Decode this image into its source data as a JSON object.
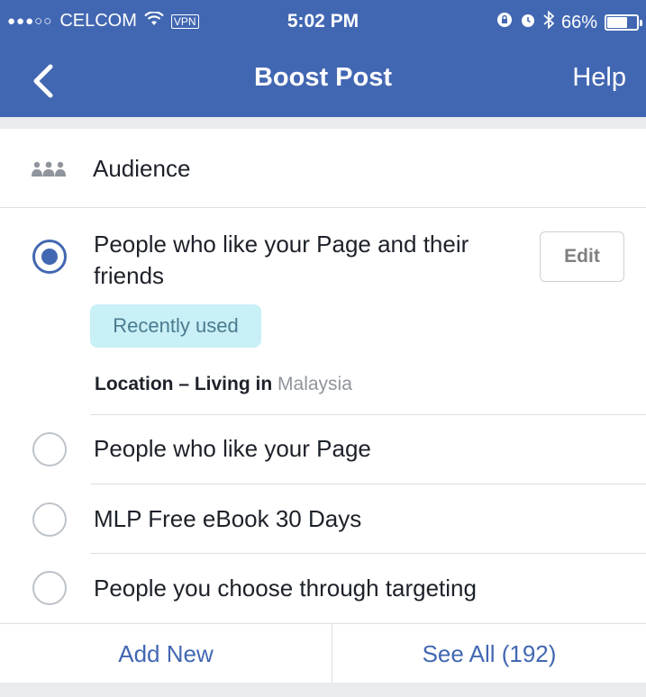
{
  "status_bar": {
    "carrier": "CELCOM",
    "vpn": "VPN",
    "time": "5:02 PM",
    "battery_text": "66%",
    "battery_level": 0.66
  },
  "nav": {
    "title": "Boost Post",
    "help_label": "Help",
    "back_icon": "chevron-left-icon"
  },
  "audience": {
    "header": "Audience",
    "header_icon": "people-icon",
    "options": [
      {
        "label": "People who like your Page and their friends",
        "selected": true
      },
      {
        "label": "People who like your Page",
        "selected": false
      },
      {
        "label": "MLP Free eBook 30 Days",
        "selected": false
      },
      {
        "label": "People you choose through targeting",
        "selected": false
      }
    ],
    "edit_label": "Edit",
    "badge": "Recently used",
    "location_label": "Location – Living in",
    "location_value": "Malaysia"
  },
  "footer": {
    "add_new": "Add New",
    "see_all": "See All (192)"
  },
  "colors": {
    "brand": "#4267b2",
    "badge_bg": "#c9f0f7"
  }
}
